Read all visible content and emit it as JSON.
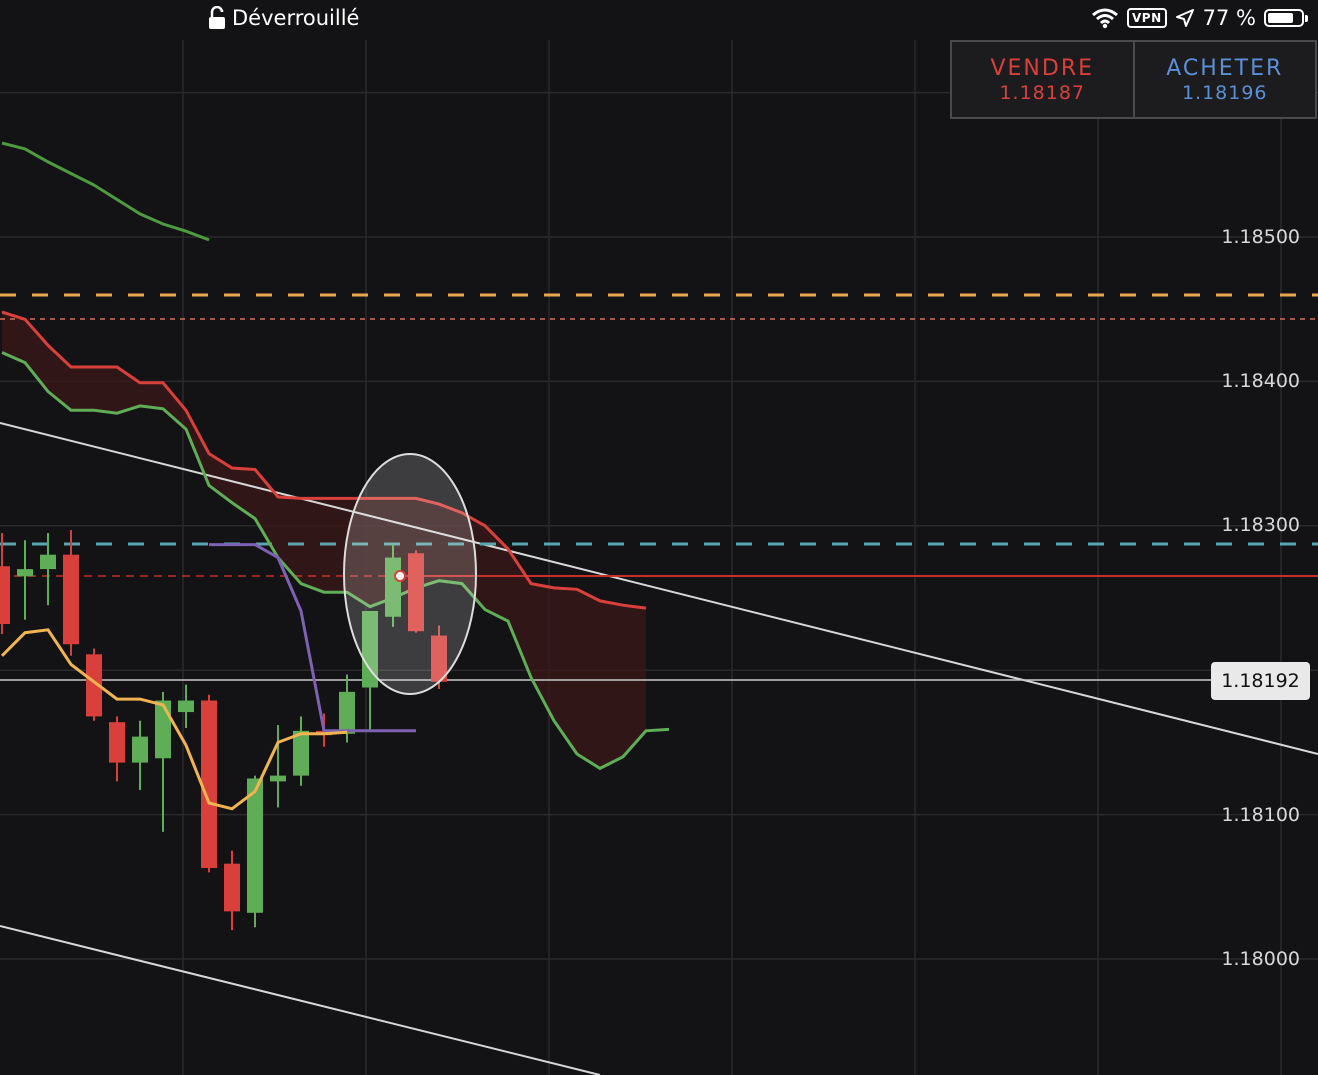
{
  "status_bar": {
    "lock_icon": "lock-open-icon",
    "lock_text": "Déverrouillé",
    "wifi_icon": "wifi-icon",
    "vpn_label": "VPN",
    "location_icon": "location-arrow-icon",
    "battery_text": "77 %",
    "battery_level": 0.77
  },
  "trade_panel": {
    "sell_label": "VENDRE",
    "sell_price": "1.18187",
    "buy_label": "ACHETER",
    "buy_price": "1.18196"
  },
  "colors": {
    "background": "#131315",
    "bull_candle": "#5fad56",
    "bear_candle": "#d9403c",
    "cloud_fill": "#3a1718",
    "senkou_a": "#d9403c",
    "senkou_b": "#5fad56",
    "tenkan": "#f2b450",
    "kijun": "#7d62b4",
    "sell": "#d9403c",
    "buy": "#5b8fd6"
  },
  "chart_data": {
    "type": "candlestick",
    "y_axis_ticks": [
      "1.18500",
      "1.18400",
      "1.18300",
      "1.18100",
      "1.18000"
    ],
    "current_price_label": "1.18192",
    "ylim": [
      1.1775,
      1.1864
    ],
    "candles": [
      {
        "o": 1.18272,
        "h": 1.18295,
        "l": 1.18225,
        "c": 1.18232
      },
      {
        "o": 1.18265,
        "h": 1.1829,
        "l": 1.18235,
        "c": 1.1827
      },
      {
        "o": 1.1827,
        "h": 1.18295,
        "l": 1.18245,
        "c": 1.1828
      },
      {
        "o": 1.1828,
        "h": 1.18297,
        "l": 1.1821,
        "c": 1.18218
      },
      {
        "o": 1.18211,
        "h": 1.18215,
        "l": 1.18165,
        "c": 1.18168
      },
      {
        "o": 1.18164,
        "h": 1.18168,
        "l": 1.18123,
        "c": 1.18136
      },
      {
        "o": 1.18136,
        "h": 1.18165,
        "l": 1.18117,
        "c": 1.18154
      },
      {
        "o": 1.18139,
        "h": 1.18185,
        "l": 1.18088,
        "c": 1.18179
      },
      {
        "o": 1.18171,
        "h": 1.1819,
        "l": 1.1816,
        "c": 1.18179
      },
      {
        "o": 1.18179,
        "h": 1.18183,
        "l": 1.1806,
        "c": 1.18063
      },
      {
        "o": 1.18066,
        "h": 1.18075,
        "l": 1.1802,
        "c": 1.18033
      },
      {
        "o": 1.18032,
        "h": 1.18127,
        "l": 1.18022,
        "c": 1.18125
      },
      {
        "o": 1.18123,
        "h": 1.18162,
        "l": 1.18105,
        "c": 1.18127
      },
      {
        "o": 1.18127,
        "h": 1.18168,
        "l": 1.1812,
        "c": 1.18158
      },
      {
        "o": 1.18158,
        "h": 1.1817,
        "l": 1.18147,
        "c": 1.18155
      },
      {
        "o": 1.18156,
        "h": 1.18197,
        "l": 1.1815,
        "c": 1.18185
      },
      {
        "o": 1.18188,
        "h": 1.18235,
        "l": 1.18158,
        "c": 1.18241
      },
      {
        "o": 1.18237,
        "h": 1.18288,
        "l": 1.1823,
        "c": 1.18278
      },
      {
        "o": 1.18281,
        "h": 1.18283,
        "l": 1.18226,
        "c": 1.18227
      },
      {
        "o": 1.18224,
        "h": 1.18231,
        "l": 1.18187,
        "c": 1.18192
      }
    ],
    "senkou_a": [
      1.18448,
      1.18443,
      1.18425,
      1.1841,
      1.1841,
      1.1841,
      1.18399,
      1.18399,
      1.1838,
      1.1835,
      1.1834,
      1.18339,
      1.1832,
      1.18319,
      1.18319,
      1.18319,
      1.18319,
      1.18319,
      1.18319,
      1.18315,
      1.18309,
      1.183,
      1.18284,
      1.1826,
      1.18257,
      1.18256,
      1.18248,
      1.18245,
      1.18243
    ],
    "senkou_b": [
      1.1842,
      1.18413,
      1.18393,
      1.1838,
      1.1838,
      1.18378,
      1.18383,
      1.18381,
      1.18367,
      1.18328,
      1.18316,
      1.18305,
      1.18278,
      1.1826,
      1.18254,
      1.18254,
      1.18244,
      1.1825,
      1.18257,
      1.18262,
      1.1826,
      1.18242,
      1.18234,
      1.18195,
      1.18165,
      1.18142,
      1.18132,
      1.1814,
      1.18158,
      1.18159
    ],
    "chikou": [
      1.18565,
      1.18561,
      1.18552,
      1.18544,
      1.18536,
      1.18526,
      1.18516,
      1.18509,
      1.18504,
      1.18498
    ],
    "tenkan": [
      1.1821,
      1.18226,
      1.18228,
      1.18204,
      1.18192,
      1.1818,
      1.1818,
      1.18176,
      1.18148,
      1.18108,
      1.18104,
      1.18116,
      1.1815,
      1.18156,
      1.18156,
      1.18157
    ],
    "kijun": [
      1.18287,
      1.18287,
      1.18287,
      1.18278,
      1.18241,
      1.18158,
      1.18158,
      1.18158,
      1.18158,
      1.18158
    ]
  }
}
